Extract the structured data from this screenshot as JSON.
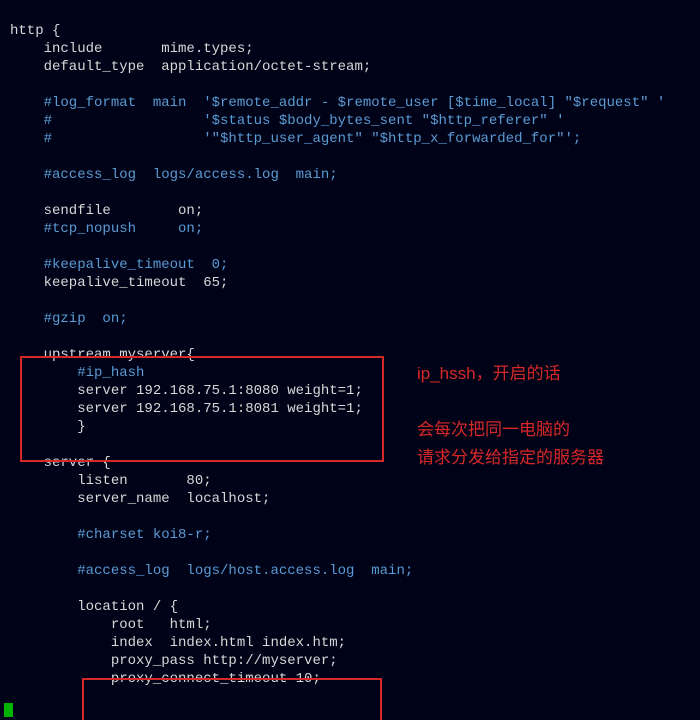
{
  "code": {
    "l01": "http {",
    "l02": "    include       mime.types;",
    "l03": "    default_type  application/octet-stream;",
    "l04": "",
    "l05": "    #log_format  main  '$remote_addr - $remote_user [$time_local] \"$request\" '",
    "l06": "    #                  '$status $body_bytes_sent \"$http_referer\" '",
    "l07": "    #                  '\"$http_user_agent\" \"$http_x_forwarded_for\"';",
    "l08": "",
    "l09": "    #access_log  logs/access.log  main;",
    "l10": "",
    "l11": "    sendfile        on;",
    "l12": "    #tcp_nopush     on;",
    "l13": "",
    "l14": "    #keepalive_timeout  0;",
    "l15": "    keepalive_timeout  65;",
    "l16": "",
    "l17": "    #gzip  on;",
    "l18": "",
    "l19": "    upstream myserver{",
    "l20": "        #ip_hash",
    "l21": "        server 192.168.75.1:8080 weight=1;",
    "l22": "        server 192.168.75.1:8081 weight=1;",
    "l23": "        }",
    "l24": "",
    "l25": "    server {",
    "l26": "        listen       80;",
    "l27": "        server_name  localhost;",
    "l28": "",
    "l29": "        #charset koi8-r;",
    "l30": "",
    "l31": "        #access_log  logs/host.access.log  main;",
    "l32": "",
    "l33": "        location / {",
    "l34": "            root   html;",
    "l35": "            index  index.html index.htm;",
    "l36": "            proxy_pass http://myserver;",
    "l37": "            proxy_connect_timeout 10;"
  },
  "annotation": {
    "line1": "ip_hssh，开启的话",
    "line2": "会每次把同一电脑的",
    "line3": "请求分发给指定的服务器"
  },
  "colors": {
    "background": "#000317",
    "text": "#d8d8d8",
    "comment": "#5a9bd4",
    "highlight_border": "#d62828",
    "annotation_text": "#d62828",
    "cursor": "#00b300"
  }
}
